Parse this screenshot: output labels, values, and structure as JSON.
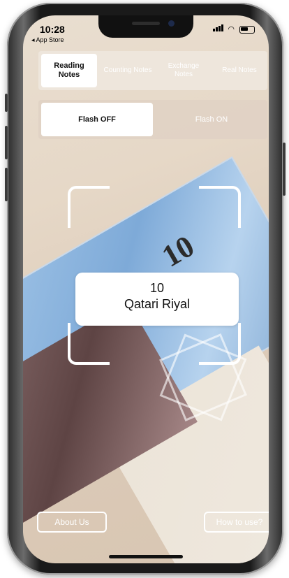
{
  "status_bar": {
    "time": "10:28",
    "back_app": "◂ App Store"
  },
  "tabs": [
    {
      "label": "Reading Notes",
      "active": true
    },
    {
      "label": "Counting Notes",
      "active": false
    },
    {
      "label": "Exchange Notes",
      "active": false
    },
    {
      "label": "Real Notes",
      "active": false
    }
  ],
  "flash": {
    "off_label": "Flash OFF",
    "on_label": "Flash ON",
    "selected": "off"
  },
  "result": {
    "amount": "10",
    "currency": "Qatari Riyal"
  },
  "buttons": {
    "about": "About Us",
    "how_to": "How to use?"
  },
  "camera_view": {
    "note_value": "10"
  },
  "colors": {
    "accent": "#ffffff",
    "background": "#e6d8c7"
  }
}
